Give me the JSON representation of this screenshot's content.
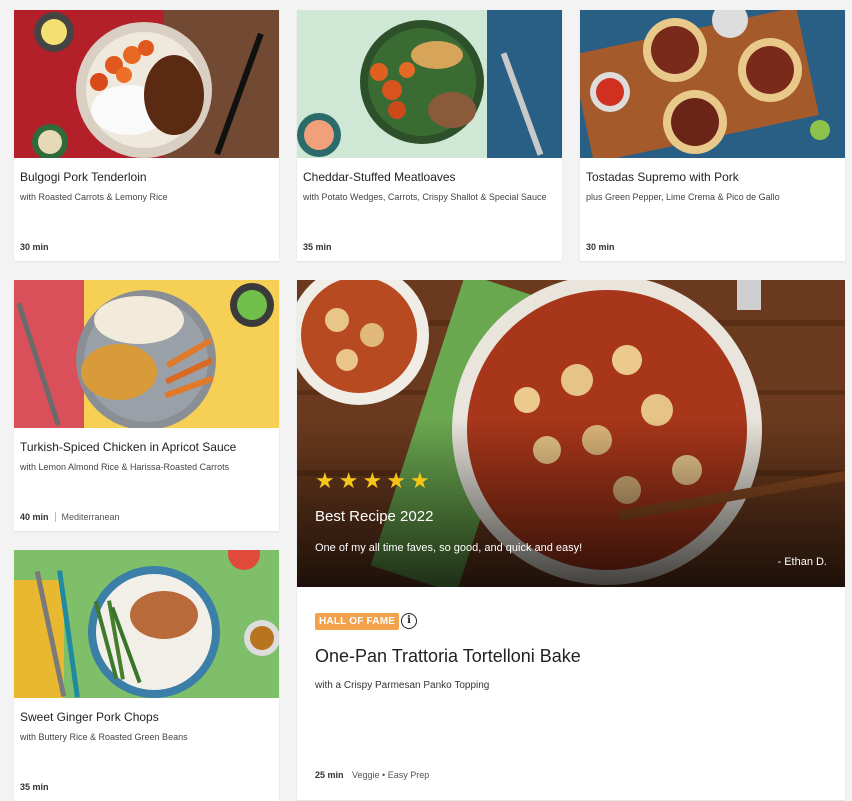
{
  "cards": [
    {
      "title": "Bulgogi Pork Tenderloin",
      "subtitle": "with Roasted Carrots & Lemony Rice",
      "time": "30 min",
      "cuisine": ""
    },
    {
      "title": "Cheddar-Stuffed Meatloaves",
      "subtitle": "with Potato Wedges, Carrots, Crispy Shallot & Special Sauce",
      "time": "35 min",
      "cuisine": ""
    },
    {
      "title": "Tostadas Supremo with Pork",
      "subtitle": "plus Green Pepper, Lime Crema & Pico de Gallo",
      "time": "30 min",
      "cuisine": ""
    },
    {
      "title": "Turkish-Spiced Chicken in Apricot Sauce",
      "subtitle": "with Lemon Almond Rice & Harissa-Roasted Carrots",
      "time": "40 min",
      "cuisine": "Mediterranean"
    },
    {
      "title": "Sweet Ginger Pork Chops",
      "subtitle": "with Buttery Rice & Roasted Green Beans",
      "time": "35 min",
      "cuisine": ""
    }
  ],
  "featured": {
    "rating": 5,
    "award": "Best Recipe 2022",
    "quote": "One of my all time faves, so good, and quick and easy!",
    "author": "- Ethan D.",
    "badge": "HALL OF FAME",
    "info_icon": "info-icon",
    "title": "One-Pan Trattoria Tortelloni Bake",
    "subtitle": "with a Crispy Parmesan Panko Topping",
    "time": "25 min",
    "tags": "Veggie • Easy Prep"
  }
}
